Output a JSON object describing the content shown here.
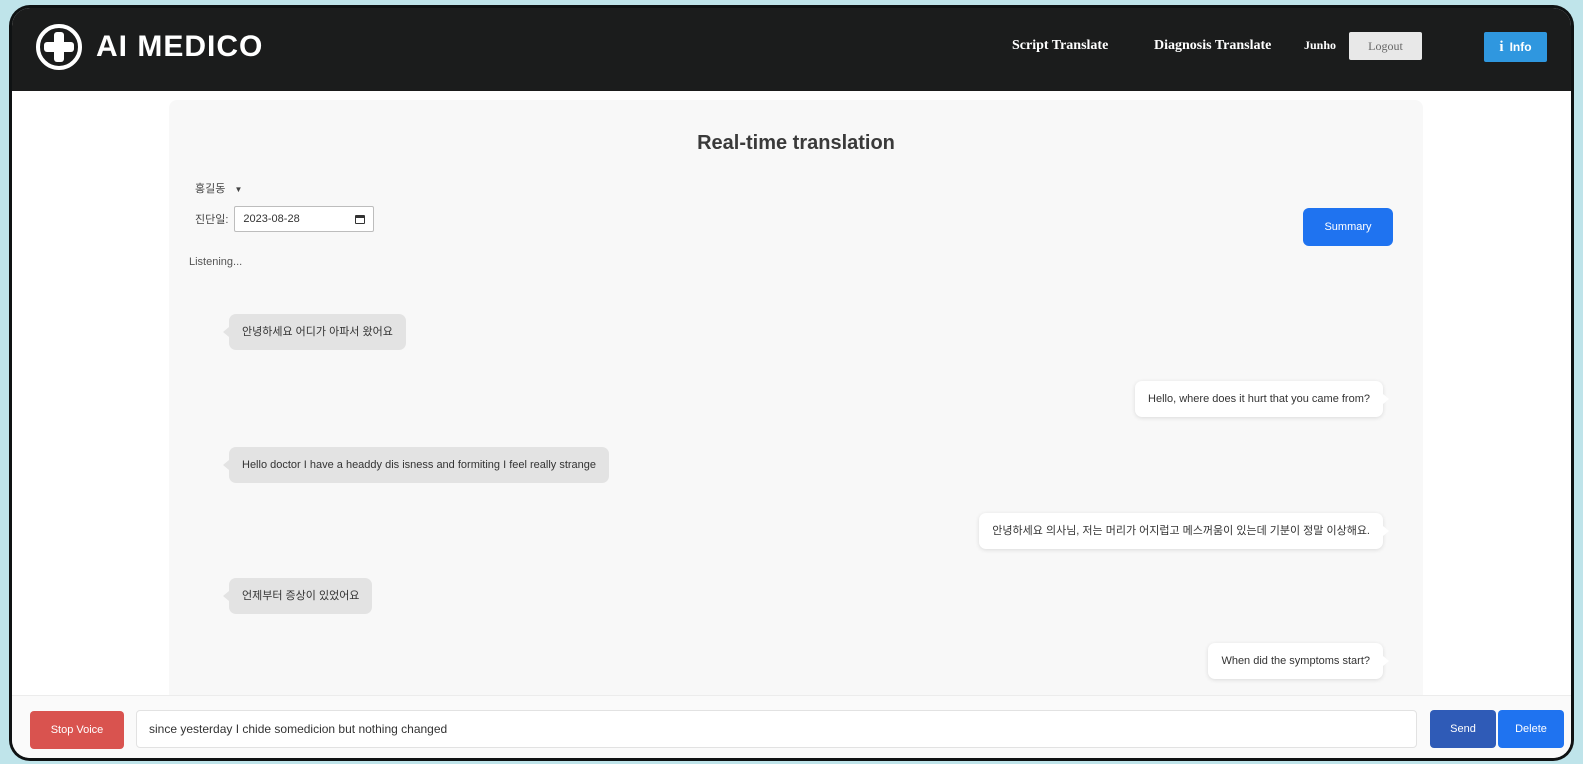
{
  "navbar": {
    "brand": "AI MEDICO",
    "links": [
      "Script Translate",
      "Diagnosis Translate"
    ],
    "user": "Junho",
    "logout_label": "Logout",
    "info_label": "Info",
    "info_icon": "info-icon"
  },
  "page": {
    "title": "Real-time translation",
    "patient_name": "홍길동",
    "patient_dropdown_icon": "caret-down-icon",
    "date_label": "진단일:",
    "date_value": "2023-08-28",
    "summary_label": "Summary",
    "status": "Listening..."
  },
  "messages": [
    {
      "side": "left",
      "text": "안녕하세요 어디가 아파서 왔어요"
    },
    {
      "side": "right",
      "text": "Hello, where does it hurt that you came from?"
    },
    {
      "side": "left",
      "text": "Hello doctor I have a headdy dis isness and formiting I feel really strange"
    },
    {
      "side": "right",
      "text": "안녕하세요 의사님, 저는 머리가 어지럽고 메스꺼움이 있는데 기분이 정말 이상해요."
    },
    {
      "side": "left",
      "text": "언제부터 증상이 있었어요"
    },
    {
      "side": "right",
      "text": "When did the symptoms start?"
    }
  ],
  "composer": {
    "stop_label": "Stop Voice",
    "input_value": "since yesterday I chide somedicion but nothing changed",
    "send_label": "Send",
    "delete_label": "Delete"
  },
  "colors": {
    "navbar_bg": "#1b1c1c",
    "primary": "#1f73f0",
    "danger": "#d9534f",
    "info": "#2f97df",
    "backdrop": "#bfe4ea"
  }
}
